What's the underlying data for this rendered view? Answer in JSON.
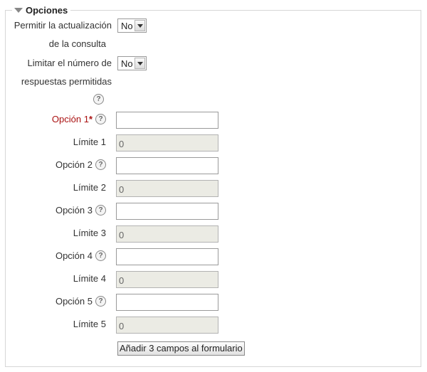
{
  "section": {
    "title": "Opciones"
  },
  "allow_update": {
    "label_line1": "Permitir la actualización",
    "label_line2": "de la consulta",
    "value": "No"
  },
  "limit_answers": {
    "label_line1": "Limitar el número de",
    "label_line2": "respuestas permitidas",
    "value": "No"
  },
  "help_glyph": "?",
  "required_mark": "*",
  "options": [
    {
      "label": "Opción 1",
      "value": "",
      "limit_label": "Límite 1",
      "limit_value": "0"
    },
    {
      "label": "Opción 2",
      "value": "",
      "limit_label": "Límite 2",
      "limit_value": "0"
    },
    {
      "label": "Opción 3",
      "value": "",
      "limit_label": "Límite 3",
      "limit_value": "0"
    },
    {
      "label": "Opción 4",
      "value": "",
      "limit_label": "Límite 4",
      "limit_value": "0"
    },
    {
      "label": "Opción 5",
      "value": "",
      "limit_label": "Límite 5",
      "limit_value": "0"
    }
  ],
  "add_fields_button": "Añadir 3 campos al formulario",
  "colors": {
    "required": "#aa1111",
    "disabled_bg": "#ebebe4",
    "border": "#d6d6d6"
  }
}
